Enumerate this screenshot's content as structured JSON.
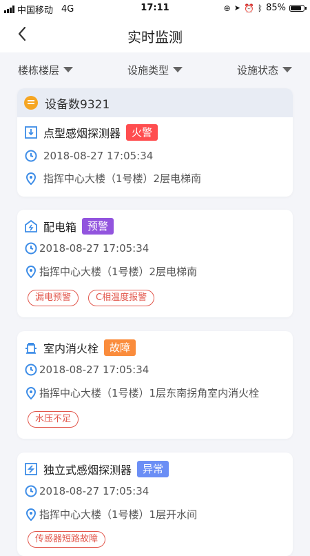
{
  "status_bar": {
    "carrier": "中国移动",
    "network": "4G",
    "time": "17:11",
    "battery": "85%"
  },
  "header": {
    "title": "实时监测"
  },
  "filters": [
    {
      "label": "楼栋楼层"
    },
    {
      "label": "设施类型"
    },
    {
      "label": "设施状态"
    }
  ],
  "summary": {
    "device_count": "设备数9321"
  },
  "alarms": [
    {
      "name": "点型感烟探测器",
      "status": "火警",
      "status_color": "#ff4d4f",
      "time": "2018-08-27  17:05:34",
      "location": "指挥中心大楼（1号楼）2层电梯南",
      "tags": []
    },
    {
      "name": "配电箱",
      "status": "预警",
      "status_color": "#9254de",
      "time": "2018-08-27    17:05:34",
      "location": "指挥中心大楼（1号楼）2层电梯南",
      "tags": [
        "漏电预警",
        "C相温度报警"
      ]
    },
    {
      "name": "室内消火栓",
      "status": "故障",
      "status_color": "#fa8c3c",
      "time": "2018-08-27    17:05:34",
      "location": "指挥中心大楼（1号楼）1层东南拐角室内消火栓",
      "tags": [
        "水压不足"
      ]
    },
    {
      "name": "独立式感烟探测器",
      "status": "异常",
      "status_color": "#6b8ef5",
      "time": "2018-08-27    17:05:34",
      "location": "指挥中心大楼（1号楼）1层开水间",
      "tags": [
        "传感器短路故障"
      ]
    }
  ],
  "colors": {
    "accent": "#3c8ce7",
    "tag": "#e2574c"
  }
}
